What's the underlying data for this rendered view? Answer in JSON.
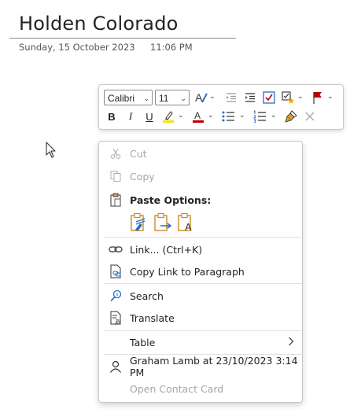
{
  "page": {
    "title": "Holden Colorado",
    "date": "Sunday, 15 October 2023",
    "time": "11:06 PM"
  },
  "toolbar": {
    "font_name": "Calibri",
    "font_size": "11",
    "colors": {
      "highlight": "#f5e50a",
      "font_color": "#c00000",
      "flag": "#c00000",
      "accent": "#2b6cc4"
    }
  },
  "context_menu": {
    "cut": "Cut",
    "copy": "Copy",
    "paste_options": "Paste Options:",
    "link": "Link...  (Ctrl+K)",
    "copy_link_to_paragraph": "Copy Link to Paragraph",
    "search": "Search",
    "translate": "Translate",
    "table": "Table",
    "author": "Graham Lamb at 23/10/2023 3:14 PM",
    "open_contact_card": "Open Contact Card"
  }
}
